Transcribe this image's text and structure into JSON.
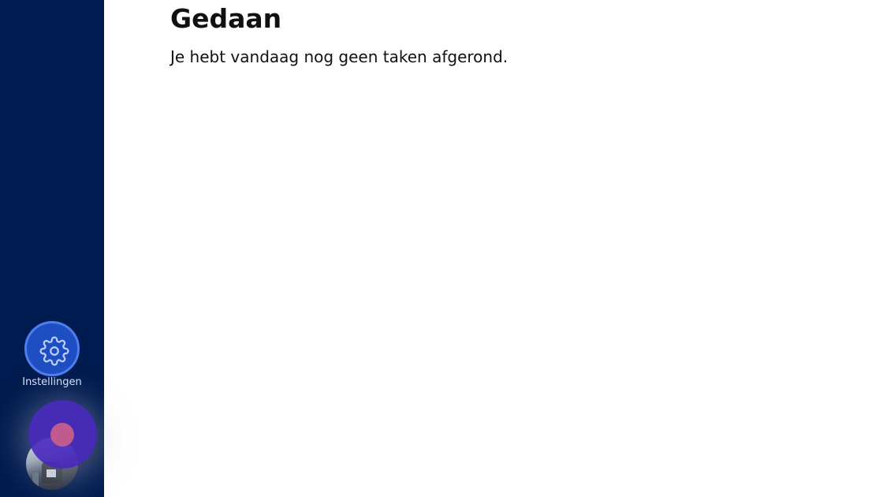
{
  "main": {
    "heading": "Gedaan",
    "message": "Je hebt vandaag nog geen taken afgerond."
  },
  "sidebar": {
    "settings": {
      "label": "Instellingen",
      "icon": "gear-icon"
    },
    "avatar": {
      "icon": "user-avatar"
    }
  },
  "fab": {
    "icon": "record-dot-icon"
  },
  "colors": {
    "sidebar_bg": "#001b4f",
    "settings_circle": "#1f4ec2",
    "fab_bg": "#4c2cbe",
    "fab_dot": "#c05a8f"
  }
}
